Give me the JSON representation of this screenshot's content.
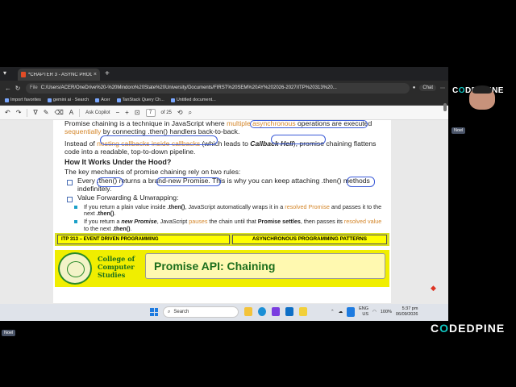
{
  "browser": {
    "tab_title": "*CHAPTER 3 - ASYNC PROGRAMMI",
    "tab_close": "×",
    "new_tab": "+",
    "url_label": "File",
    "url": "C:/Users/ACER/OneDrive%20-%20Mindoro%20State%20University/Documents/FIRST%20SEM%20AY%202026-2027/ITP%20313%20...",
    "chat_label": "Chat",
    "bookmarks": [
      "Import favorites",
      "gemini ai · Search",
      "Acer",
      "TanStack Query Ch...",
      "Untitled document..."
    ]
  },
  "pdf_toolbar": {
    "ask_copilot": "Ask Copilot",
    "minus": "−",
    "plus": "+",
    "page_current": "7",
    "page_total": "of 25"
  },
  "slide": {
    "p1_a": "Promise chaining is a technique in JavaScript where ",
    "p1_hl1": "multiple asynchronous",
    "p1_b": " operations are executed ",
    "p1_hl2": "sequentially",
    "p1_c": " by connecting .then() handlers back-to-back.",
    "p2_a": "Instead of ",
    "p2_hl": "nesting callbacks inside callbacks",
    "p2_b": " (which leads to ",
    "p2_bi": "Callback Hell",
    "p2_c": "), promise chaining flattens code into a readable, top-to-down pipeline.",
    "h3": "How It Works Under the Hood?",
    "intro": "The key mechanics of promise chaining rely on two rules:",
    "rule1": "Every .then() returns a brand-new Promise. This is why you can keep attaching .then() methods indefinitely.",
    "rule2": "Value Forwarding & Unwrapping:",
    "sub1_a": "If you return a plain value inside ",
    "sub1_b": ".then()",
    "sub1_c": ", JavaScript automatically wraps it in a ",
    "sub1_hl": "resolved Promise",
    "sub1_d": " and passes it to the next ",
    "sub1_e": ".then()",
    "sub1_f": ".",
    "sub2_a": "If you return a ",
    "sub2_bi": "new Promise",
    "sub2_b": ", JavaScript ",
    "sub2_hl1": "pauses",
    "sub2_c": " the chain until that ",
    "sub2_bold": "Promise settles",
    "sub2_d": ", then passes its ",
    "sub2_hl2": "resolved value",
    "sub2_e": " to the next ",
    "sub2_f": ".then()",
    "sub2_g": ".",
    "footer_left": "ITP 313 – EVENT DRIVEN PROGRAMMING",
    "footer_right": "ASYNCHRONOUS PROGRAMMING PATTERNS",
    "college_line1": "College of",
    "college_line2": "Computer",
    "college_line3": "Studies",
    "title": "Promise API: Chaining"
  },
  "taskbar": {
    "search_placeholder": "Search",
    "lang_line1": "ENG",
    "lang_line2": "US",
    "battery": "100%",
    "time": "5:37 pm",
    "date": "06/09/2026"
  },
  "overlay": {
    "brand_small_a": "C",
    "brand_small_o": "O",
    "brand_small_b": "DEDPINE",
    "user_tag": "Noel",
    "user_tag2": "Noel",
    "brand_big_a": "C",
    "brand_big_o": "O",
    "brand_big_b": "DEDPINE"
  },
  "colors": {
    "accent": "#d4862a",
    "footer_yellow": "#ffff00",
    "title_green": "#1c6e1c",
    "brand_teal": "#11c7c3"
  }
}
